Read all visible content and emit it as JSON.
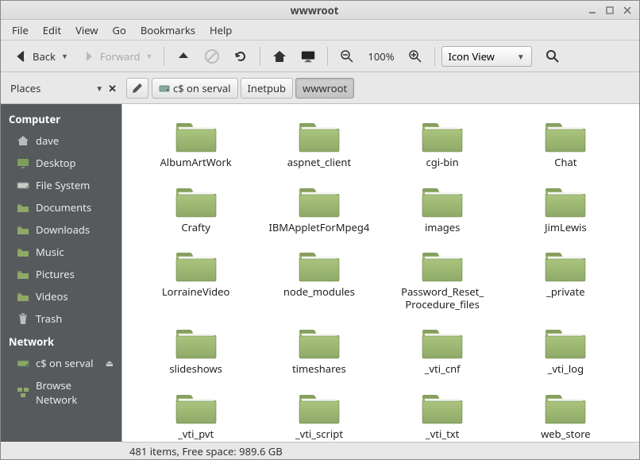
{
  "window": {
    "title": "wwwroot"
  },
  "menubar": [
    "File",
    "Edit",
    "View",
    "Go",
    "Bookmarks",
    "Help"
  ],
  "toolbar": {
    "back": "Back",
    "forward": "Forward",
    "zoom": "100%",
    "view_mode": "Icon View"
  },
  "places_label": "Places",
  "breadcrumbs": [
    {
      "label": "c$ on serval",
      "hasIcon": true,
      "active": false
    },
    {
      "label": "Inetpub",
      "hasIcon": false,
      "active": false
    },
    {
      "label": "wwwroot",
      "hasIcon": false,
      "active": true
    }
  ],
  "sidebar": {
    "sections": [
      {
        "heading": "Computer",
        "items": [
          {
            "label": "dave",
            "icon": "home"
          },
          {
            "label": "Desktop",
            "icon": "desktop"
          },
          {
            "label": "File System",
            "icon": "drive"
          },
          {
            "label": "Documents",
            "icon": "folder"
          },
          {
            "label": "Downloads",
            "icon": "folder"
          },
          {
            "label": "Music",
            "icon": "folder"
          },
          {
            "label": "Pictures",
            "icon": "folder"
          },
          {
            "label": "Videos",
            "icon": "folder"
          },
          {
            "label": "Trash",
            "icon": "trash"
          }
        ]
      },
      {
        "heading": "Network",
        "items": [
          {
            "label": "c$ on serval",
            "icon": "netdrive",
            "eject": true
          },
          {
            "label": "Browse Network",
            "icon": "network"
          }
        ]
      }
    ]
  },
  "files": [
    "AlbumArtWork",
    "aspnet_client",
    "cgi-bin",
    "Chat",
    "Crafty",
    "IBMAppletForMpeg4",
    "images",
    "JimLewis",
    "LorraineVideo",
    "node_modules",
    "Password_Reset_Procedure_files",
    "_private",
    "slideshows",
    "timeshares",
    "_vti_cnf",
    "_vti_log",
    "_vti_pvt",
    "_vti_script",
    "_vti_txt",
    "web_store"
  ],
  "statusbar": "481 items, Free space: 989.6 GB"
}
